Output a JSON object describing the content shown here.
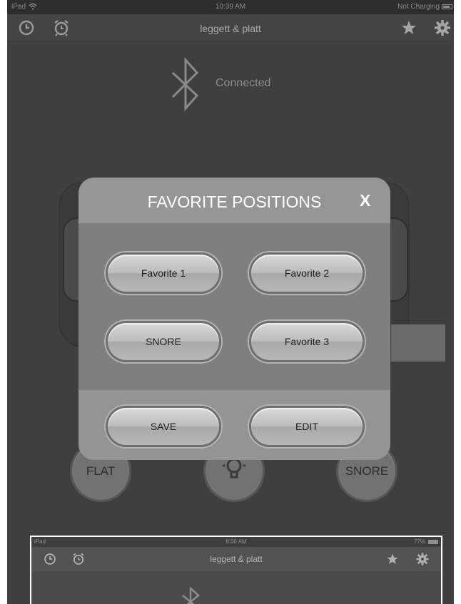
{
  "status_bar": {
    "device": "iPad",
    "time": "10:39 AM",
    "charging": "Not Charging"
  },
  "nav": {
    "title": "leggett & platt",
    "icons": [
      "clock-icon",
      "alarm-icon",
      "star-icon",
      "gear-icon"
    ]
  },
  "bluetooth": {
    "status": "Connected"
  },
  "modal": {
    "title": "FAVORITE POSITIONS",
    "close": "X",
    "buttons": [
      "Favorite 1",
      "Favorite 2",
      "SNORE",
      "Favorite 3"
    ],
    "footer_buttons": [
      "SAVE",
      "EDIT"
    ]
  },
  "background_buttons": [
    "FLAT",
    "SNORE"
  ],
  "inset": {
    "status": {
      "device": "iPad",
      "time": "8:06 AM",
      "battery": "77%"
    },
    "nav_title": "leggett & platt"
  },
  "colors": {
    "modal_bg": "#8b8b8b",
    "text_on_modal": "#ffffff",
    "app_bg": "#3f3f3f"
  }
}
